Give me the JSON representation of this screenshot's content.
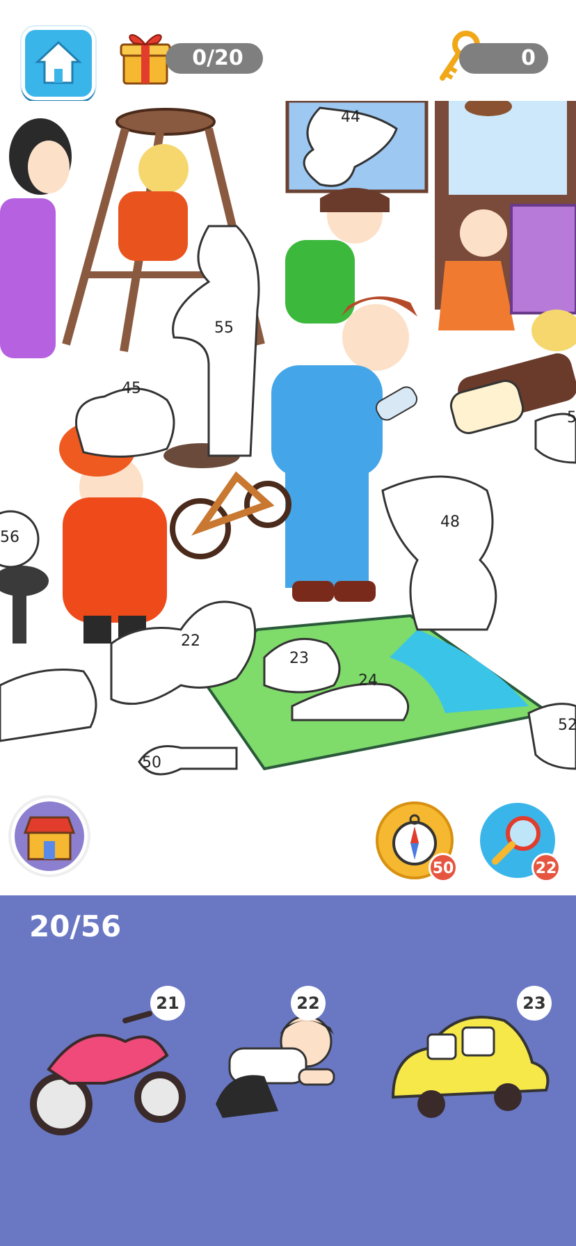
{
  "header": {
    "found_progress": "0/20",
    "keys_count": "0"
  },
  "scene": {
    "silhouette_labels": [
      "44",
      "55",
      "45",
      "56",
      "48",
      "22",
      "23",
      "24",
      "50",
      "52",
      "5"
    ]
  },
  "boosters": {
    "compass_count": "50",
    "magnifier_count": "22"
  },
  "tray": {
    "count_label": "20/56",
    "items": [
      {
        "number": "21",
        "name": "motorcycle"
      },
      {
        "number": "22",
        "name": "crawling-boy"
      },
      {
        "number": "23",
        "name": "toy-car"
      }
    ]
  },
  "colors": {
    "tray_bg": "#6a78c4",
    "home_button": "#3ab5ea",
    "pill_bg": "#7f7f7f",
    "badge_red": "#e5553f"
  }
}
